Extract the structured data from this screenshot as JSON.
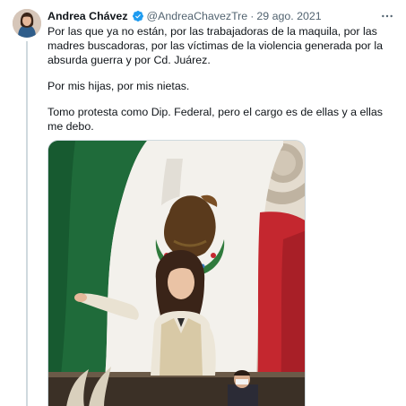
{
  "tweet": {
    "author": {
      "display_name": "Andrea Chávez",
      "handle": "@AndreaChavezTre",
      "verified": true
    },
    "separator": "·",
    "date": "29 ago. 2021",
    "paragraphs": [
      "Por las que ya no están, por las trabajadoras de la maquila, por las madres buscadoras, por las víctimas de la violencia generada por la absurda guerra y por Cd. Juárez.",
      "Por mis hijas, por mis nietas.",
      "Tomo protesta como Dip. Federal, pero el cargo es de ellas y a ellas me debo."
    ],
    "media": {
      "description_icon": "photo"
    }
  },
  "colors": {
    "verified_blue": "#1d9bf0",
    "secondary_text": "#536471",
    "thread_line": "#cfd9de",
    "flag_green": "#1f6b3a",
    "flag_red": "#c4272f"
  },
  "icons": {
    "more": "more-horizontal-icon",
    "verified": "verified-badge-icon"
  }
}
